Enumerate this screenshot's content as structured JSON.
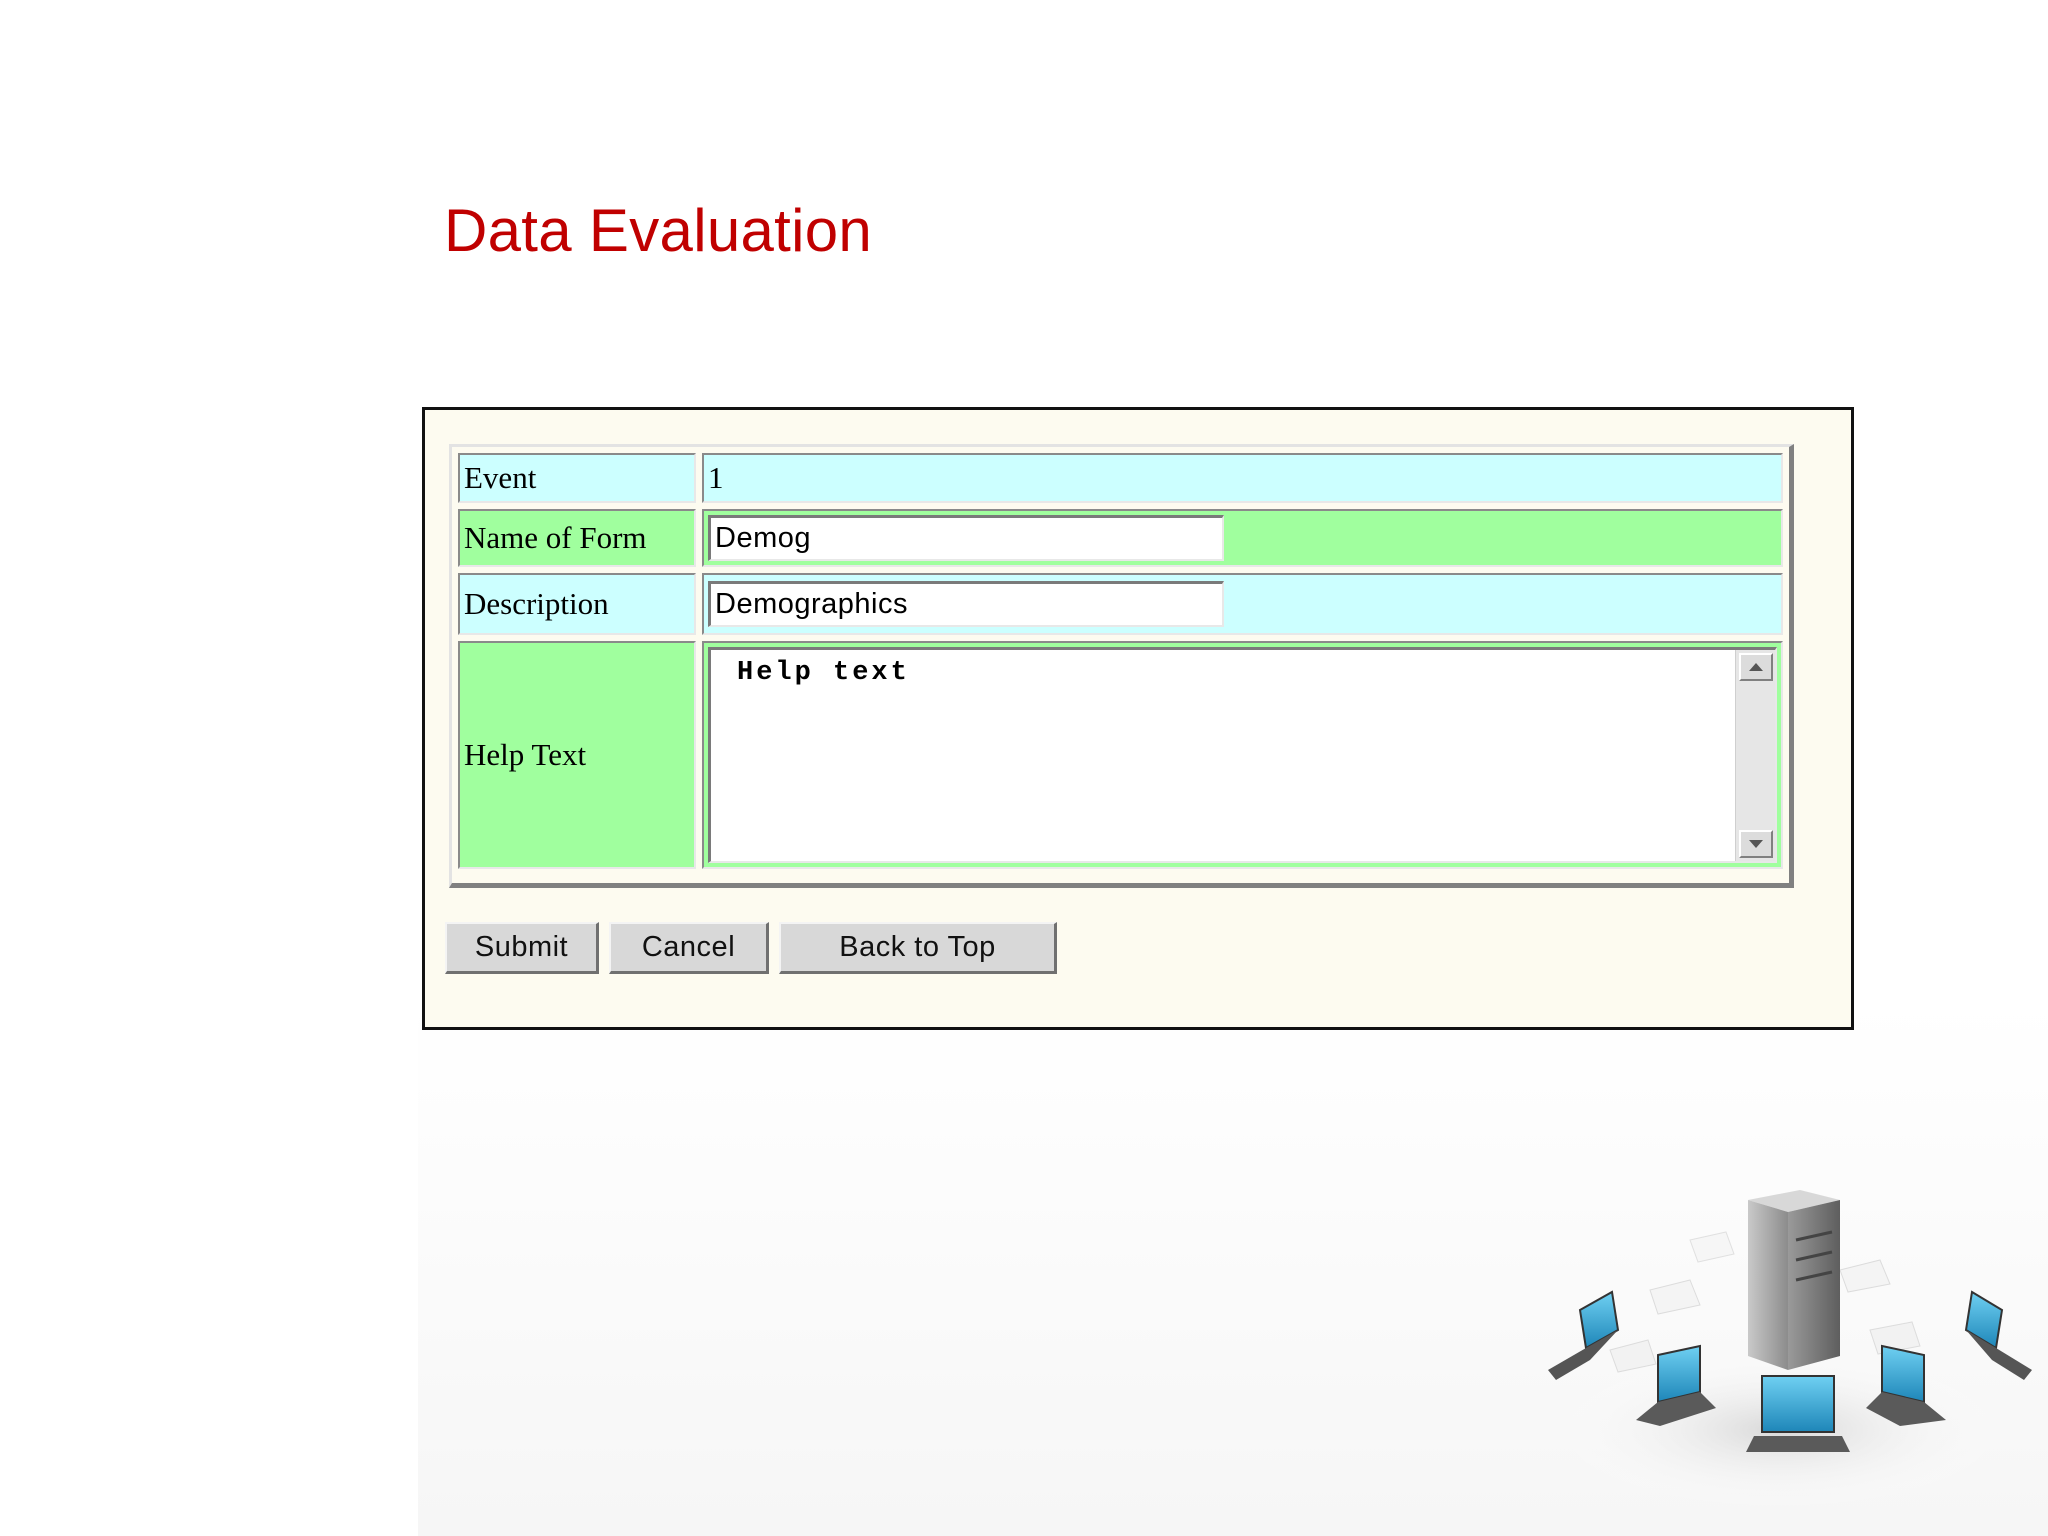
{
  "slide": {
    "title": "Data Evaluation"
  },
  "form": {
    "rows": [
      {
        "label": "Event",
        "value": "1"
      },
      {
        "label": "Name of Form",
        "value": "Demog"
      },
      {
        "label": "Description",
        "value": "Demographics"
      },
      {
        "label": "Help Text",
        "value": "Help text"
      }
    ],
    "buttons": {
      "submit": "Submit",
      "cancel": "Cancel",
      "back_to_top": "Back to Top"
    }
  },
  "colors": {
    "title": "#c00000",
    "row_cyan": "#ccffff",
    "row_green": "#a0ff9e",
    "frame_background": "#fdfbf0"
  },
  "decorations": {
    "clipart": "server-network-illustration",
    "scroll_up_icon": "arrow-up-icon",
    "scroll_down_icon": "arrow-down-icon"
  }
}
